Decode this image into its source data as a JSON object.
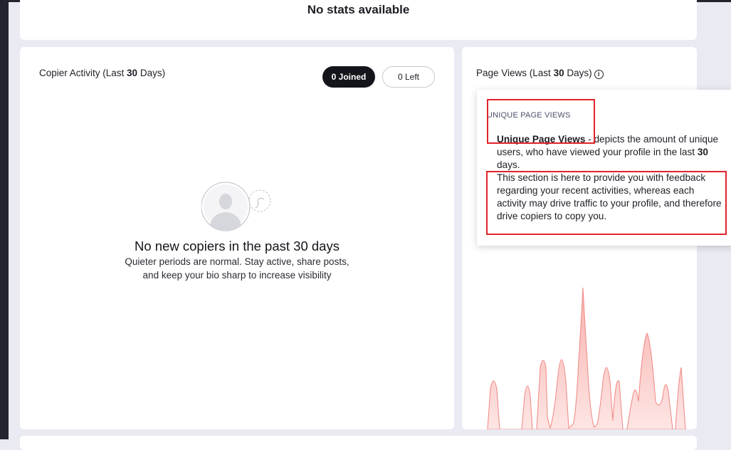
{
  "stats": {
    "empty_text": "No stats available"
  },
  "copier_activity": {
    "title_prefix": "Copier Activity (Last ",
    "title_days": "30",
    "title_suffix": " Days)",
    "joined_label": "0 Joined",
    "left_label": "0 Left",
    "empty_heading": "No new copiers in the past 30 days",
    "empty_text": "Quieter periods are normal. Stay active, share posts, and keep your bio sharp to increase visibility"
  },
  "page_views": {
    "title_prefix": "Page Views (Last ",
    "title_days": "30",
    "title_suffix": " Days)",
    "info_glyph": "i"
  },
  "tooltip": {
    "heading": "UNIQUE PAGE VIEWS",
    "term": "Unique Page Views",
    "def_rest": " - depicts the amount of unique users, who have viewed your profile in the last ",
    "days": "30",
    "def_end": " days.",
    "section_text": "This section is here to provide you with feedback regarding your recent activities, whereas each activity may drive traffic to your profile, and therefore drive copiers to copy you."
  },
  "colors": {
    "accent_dark": "#14151b",
    "chart_fill": "#f9c3c0",
    "chart_stroke": "#f08f8b",
    "highlight": "#e0242c"
  }
}
